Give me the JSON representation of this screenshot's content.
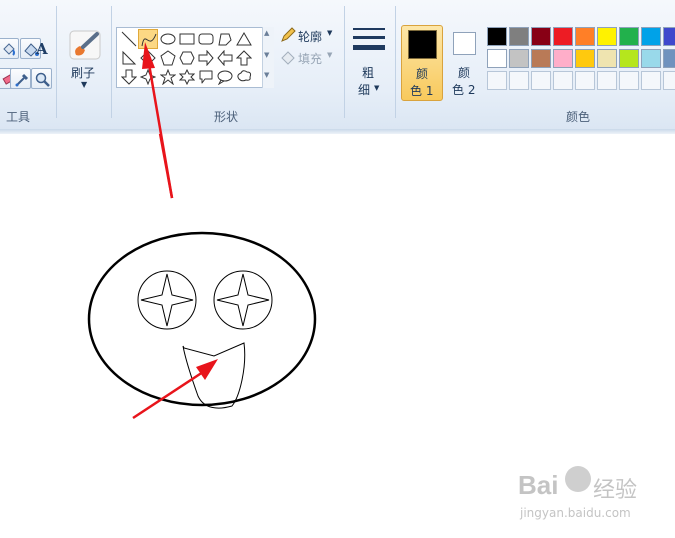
{
  "ribbon": {
    "groups": {
      "tools_label": "工具",
      "shapes_label": "形状",
      "colors_label": "颜色"
    },
    "brushes": {
      "label": "刷子"
    },
    "outline": {
      "label": "轮廓"
    },
    "fill": {
      "label": "填充"
    },
    "size": {
      "label_line1": "粗",
      "label_line2": "细"
    },
    "color1": {
      "label_line1": "颜",
      "label_line2": "色 1",
      "value": "#000000"
    },
    "color2": {
      "label_line1": "颜",
      "label_line2": "色 2",
      "value": "#ffffff"
    },
    "palette_row1": [
      "#000000",
      "#7f7f7f",
      "#880015",
      "#ed1c24",
      "#ff7f27",
      "#fff200",
      "#22b14c",
      "#00a2e8",
      "#3f48cc"
    ],
    "palette_row2": [
      "#ffffff",
      "#c3c3c3",
      "#b97a57",
      "#ffaec9",
      "#ffc90e",
      "#efe4b0",
      "#b5e61d",
      "#99d9ea",
      "#7092be"
    ]
  },
  "shapes": [
    "line",
    "curve",
    "oval",
    "rectangle",
    "rounded-rectangle",
    "polygon",
    "triangle",
    "scroll-up",
    "right-triangle",
    "diamond",
    "pentagon",
    "hexagon",
    "right-arrow",
    "left-arrow",
    "up-arrow",
    "down-arrow",
    "four-point-star",
    "five-point-star",
    "six-point-star",
    "rounded-callout",
    "oval-callout",
    "cloud-callout"
  ],
  "selected_shape": "curve",
  "accent_colors": {
    "annotation_arrow": "#e8141b",
    "selection": "#f8c95c"
  },
  "watermark": {
    "brand": "Bai",
    "brand2": "经验",
    "url": "jingyan.baidu.com"
  }
}
